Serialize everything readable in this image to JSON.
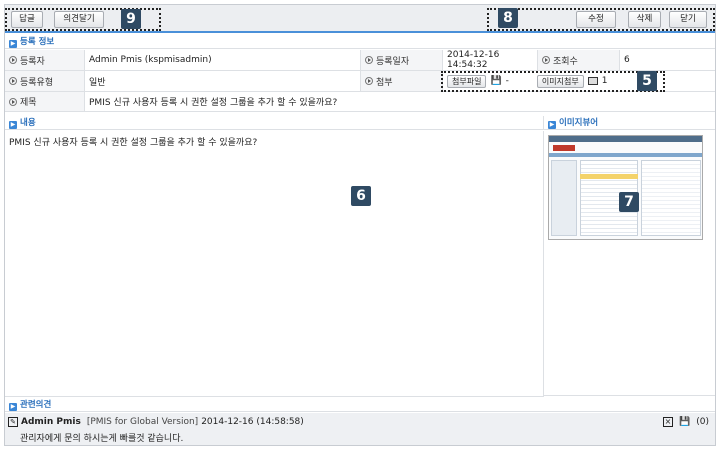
{
  "toolbar": {
    "reply": "답글",
    "add_comment": "의견달기",
    "edit": "수정",
    "delete": "삭제",
    "close": "닫기"
  },
  "badges": {
    "b9": "9",
    "b8": "8",
    "b5": "5",
    "b6": "6",
    "b7": "7"
  },
  "sections": {
    "register_info": "등록 정보",
    "content": "내용",
    "image_viewer": "이미지뷰어",
    "related_opinions": "관련의견"
  },
  "fields": {
    "registrant_label": "등록자",
    "registrant_value": "Admin Pmis (kspmisadmin)",
    "reg_date_label": "등록일자",
    "reg_date_value": "2014-12-16 14:54:32",
    "views_label": "조회수",
    "views_value": "6",
    "reg_type_label": "등록유형",
    "reg_type_value": "일반",
    "attachment_label": "첨부",
    "attach_file_btn": "첨부파일",
    "attach_file_count": "-",
    "image_attach_btn": "이미지첨부",
    "image_attach_count": "1",
    "title_label": "제목",
    "title_value": "PMIS 신규 사용자 등록 시 권한 설정 그룹을 추가 할 수 있을까요?"
  },
  "content_text": "PMIS 신규 사용자 등록 시 권한 설정 그룹을 추가 할 수 있을까요?",
  "opinion": {
    "author": "Admin Pmis",
    "version": "[PMIS for Global Version]",
    "datetime": "2014-12-16 (14:58:58)",
    "text": "관리자에게 문의 하시는게 빠를것 같습니다.",
    "attach_count": "(0)"
  },
  "colors": {
    "accent": "#4a90d9",
    "section_text": "#2a6fbb",
    "badge": "#2f4a63"
  }
}
